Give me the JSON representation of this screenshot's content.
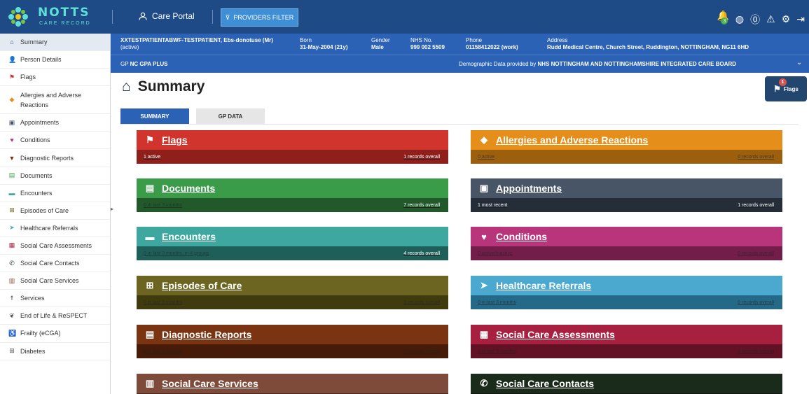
{
  "header": {
    "logo_title": "NOTTS",
    "logo_sub": "CARE RECORD",
    "portal_label": "Care Portal",
    "filter_label": "PROVIDERS FILTER",
    "notif_count": "3",
    "icons": [
      "bell-icon",
      "globe-icon",
      "help-icon",
      "warning-icon",
      "gear-icon",
      "logout-icon"
    ]
  },
  "patient": {
    "name": "XXTESTPATIENTABWF-TESTPATIENT, Ebs-donotuse (Mr)",
    "status": "(active)",
    "born_label": "Born",
    "born_value": "31-May-2004 (21y)",
    "gender_label": "Gender",
    "gender_value": "Male",
    "nhs_label": "NHS No.",
    "nhs_value": "999 002 5509",
    "phone_label": "Phone",
    "phone_value": "01158412022 (work)",
    "address_label": "Address",
    "address_value": "Rudd Medical Centre, Church Street, Ruddington, NOTTINGHAM, NG11 6HD",
    "gp_label": "GP",
    "gp_value": "NC GPA PLUS",
    "demographic_text": "Demographic Data provided by",
    "demographic_value": "NHS NOTTINGHAM AND NOTTINGHAMSHIRE INTEGRATED CARE BOARD"
  },
  "sidebar": {
    "items": [
      {
        "label": "Summary",
        "icon": "home-icon"
      },
      {
        "label": "Person Details",
        "icon": "person-icon"
      },
      {
        "label": "Flags",
        "icon": "flag-icon"
      },
      {
        "label": "Allergies and Adverse Reactions",
        "icon": "allergy-icon"
      },
      {
        "label": "Appointments",
        "icon": "calendar-icon"
      },
      {
        "label": "Conditions",
        "icon": "heart-icon"
      },
      {
        "label": "Diagnostic Reports",
        "icon": "test-tube-icon"
      },
      {
        "label": "Documents",
        "icon": "document-icon"
      },
      {
        "label": "Encounters",
        "icon": "chat-icon"
      },
      {
        "label": "Episodes of Care",
        "icon": "plus-square-icon"
      },
      {
        "label": "Healthcare Referrals",
        "icon": "arrow-icon"
      },
      {
        "label": "Social Care Assessments",
        "icon": "clipboard-icon"
      },
      {
        "label": "Social Care Contacts",
        "icon": "phone-icon"
      },
      {
        "label": "Social Care Services",
        "icon": "list-icon"
      },
      {
        "label": "Services",
        "icon": "services-icon"
      },
      {
        "label": "End of Life & ReSPECT",
        "icon": "hand-icon"
      },
      {
        "label": "Frailty (eCGA)",
        "icon": "walker-icon"
      },
      {
        "label": "Diabetes",
        "icon": "plus-square-icon"
      }
    ]
  },
  "page": {
    "title": "Summary",
    "tabs": [
      "SUMMARY",
      "GP DATA"
    ],
    "flags_float_label": "Flags",
    "flags_float_count": "1"
  },
  "cards": [
    {
      "title": "Flags",
      "left": "1 active",
      "right": "1 records overall",
      "icon": "flag-icon",
      "color": "#d0342c",
      "foot": "#8e1f1a"
    },
    {
      "title": "Allergies and Adverse Reactions",
      "left": "0 active",
      "right": "0 records overall",
      "icon": "allergy-icon",
      "color": "#e58e1a",
      "foot": "#9b5f0e"
    },
    {
      "title": "Documents",
      "left": "0 in last 3 months",
      "right": "7 records overall",
      "icon": "document-icon",
      "color": "#3a9c48",
      "foot": "#21592a"
    },
    {
      "title": "Appointments",
      "left": "1 most recent",
      "right": "1 records overall",
      "icon": "calendar-icon",
      "color": "#485566",
      "foot": "#252d38"
    },
    {
      "title": "Encounters",
      "left": "0 in last 3 months, in 4 groups",
      "right": "4 records overall",
      "icon": "chat-icon",
      "color": "#3ea8a0",
      "foot": "#1f5f5a"
    },
    {
      "title": "Conditions",
      "left": "0 active/inactive",
      "right": "0 records overall",
      "icon": "heart-icon",
      "color": "#b9357b",
      "foot": "#721d4a"
    },
    {
      "title": "Episodes of Care",
      "left": "0 in last 3 months",
      "right": "0 records overall",
      "icon": "plus-square-icon",
      "color": "#6b6521",
      "foot": "#403b0f"
    },
    {
      "title": "Healthcare Referrals",
      "left": "0 in last 3 months",
      "right": "0 records overall",
      "icon": "arrow-icon",
      "color": "#4ba9d0",
      "foot": "#246987"
    },
    {
      "title": "Diagnostic Reports",
      "left": "0 in last 3 months",
      "right": "0 records overall",
      "icon": "report-icon",
      "color": "#7a3412",
      "foot": "#461b07"
    },
    {
      "title": "Social Care Assessments",
      "left": "0 in last 3 months",
      "right": "0 records overall",
      "icon": "clipboard-icon",
      "color": "#a8203f",
      "foot": "#631124"
    },
    {
      "title": "Social Care Services",
      "left": "",
      "right": "",
      "icon": "list-icon",
      "color": "#7e4b3b",
      "foot": "#4a2a20"
    },
    {
      "title": "Social Care Contacts",
      "left": "",
      "right": "",
      "icon": "phone-icon",
      "color": "#1b2b1b",
      "foot": "#0f170f"
    }
  ]
}
